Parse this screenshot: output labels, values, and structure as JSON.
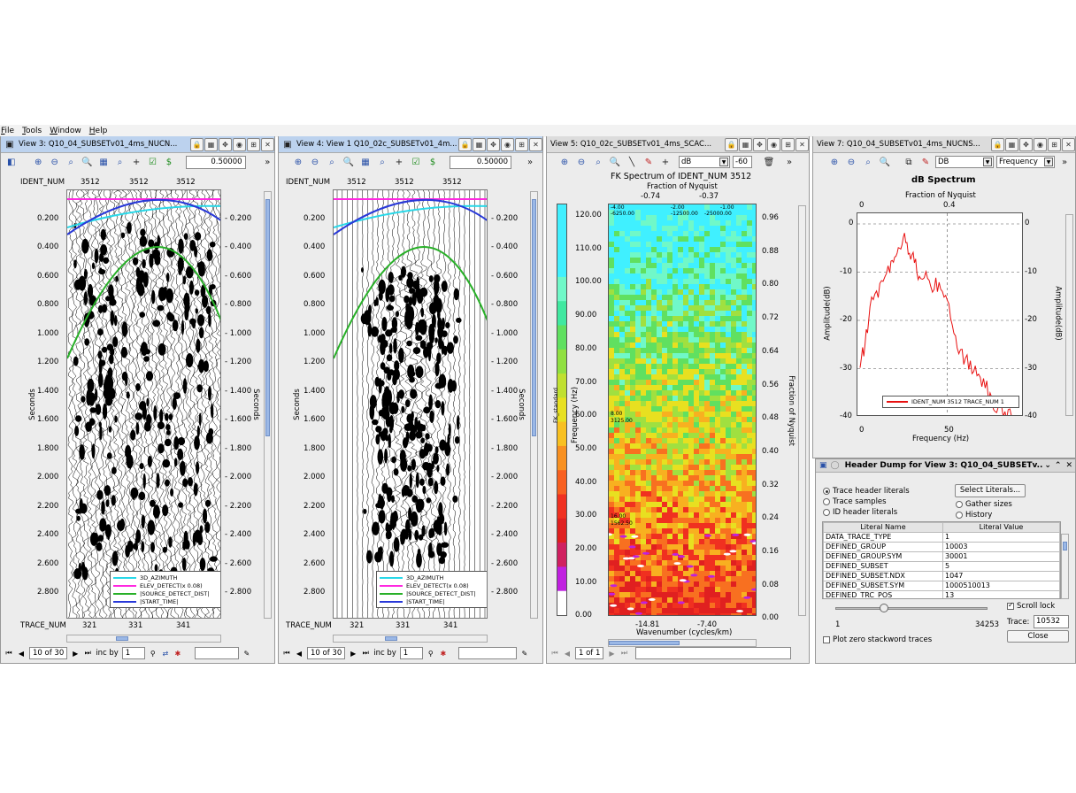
{
  "menu": [
    "File",
    "Tools",
    "Window",
    "Help"
  ],
  "view3": {
    "title": "View 3: Q10_04_SUBSETv01_4ms_NUCN...",
    "scale": "0.50000",
    "ident_label": "IDENT_NUM",
    "ident_ticks": [
      "3512",
      "3512",
      "3512"
    ],
    "trace_label": "TRACE_NUM",
    "trace_ticks": [
      "321",
      "331",
      "341"
    ],
    "axis_title": "Seconds",
    "time_ticks": [
      "0.200",
      "0.400",
      "0.600",
      "0.800",
      "1.000",
      "1.200",
      "1.400",
      "1.600",
      "1.800",
      "2.000",
      "2.200",
      "2.400",
      "2.600",
      "2.800"
    ],
    "page": "10 of 30",
    "inc_label": "inc by",
    "inc_value": "1"
  },
  "view4": {
    "title": "View 4: View 1 Q10_02c_SUBSETv01_4m...",
    "scale": "0.50000",
    "ident_label": "IDENT_NUM",
    "ident_ticks": [
      "3512",
      "3512",
      "3512"
    ],
    "trace_label": "TRACE_NUM",
    "trace_ticks": [
      "321",
      "331",
      "341"
    ],
    "axis_title": "Seconds",
    "page": "10 of 30",
    "inc_label": "inc by",
    "inc_value": "1"
  },
  "legend": [
    {
      "label": "3D_AZIMUTH",
      "color": "#28d8e8"
    },
    {
      "label": "ELEV_DETECT(x 0.08)",
      "color": "#ff28e0"
    },
    {
      "label": "|SOURCE_DETECT_DIST|",
      "color": "#28b028"
    },
    {
      "label": "|START_TIME|",
      "color": "#2838d8"
    }
  ],
  "view5": {
    "title": "View 5: Q10_02c_SUBSETv01_4ms_SCAC...",
    "unit": "dB",
    "db_min": "-60",
    "plot_title": "FK Spectrum of IDENT_NUM 3512",
    "top_axis_title": "Fraction of Nyquist",
    "top_ticks": [
      "-0.74",
      "-0.37"
    ],
    "colorbar_label": "FK_standard",
    "freq_label": "Frequency (Hz)",
    "freq_ticks": [
      "120.00",
      "110.00",
      "100.00",
      "90.00",
      "80.00",
      "70.00",
      "60.00",
      "50.00",
      "40.00",
      "30.00",
      "20.00",
      "10.00",
      "0.00"
    ],
    "nyq_ticks": [
      "0.96",
      "0.88",
      "0.80",
      "0.72",
      "0.64",
      "0.56",
      "0.48",
      "0.40",
      "0.32",
      "0.24",
      "0.16",
      "0.08",
      "0.00"
    ],
    "nyq_label": "Fraction of Nyquist",
    "wn_ticks": [
      "-14.81",
      "-7.40"
    ],
    "wn_label": "Wavenumber (cycles/km)",
    "annotations": [
      "-4.00",
      "-6250.00",
      "-2.00",
      "-12500.00",
      "-1.00",
      "-25000.00",
      "8.00",
      "3125.00",
      "16.00",
      "1562.50"
    ],
    "page": "1 of 1"
  },
  "view7": {
    "title": "View 7: Q10_04_SUBSETv01_4ms_NUCNS...",
    "unit": "DB",
    "domain": "Frequency",
    "plot_title": "dB Spectrum",
    "top_axis_title": "Fraction of Nyquist",
    "top_ticks": [
      "0",
      "0.4"
    ],
    "y_ticks": [
      "0",
      "-10",
      "-20",
      "-30",
      "-40"
    ],
    "y_label": "Amplitude(dB)",
    "x_ticks": [
      "0",
      "50"
    ],
    "x_label": "Frequency (Hz)",
    "legend": "IDENT_NUM 3512 TRACE_NUM 1"
  },
  "dump": {
    "title": "Header Dump for View 3: Q10_04_SUBSETv...",
    "radios_left": [
      "Trace header literals",
      "Trace samples",
      "ID header literals"
    ],
    "radios_right": [
      "Gather sizes",
      "History"
    ],
    "select_button": "Select Literals...",
    "columns": [
      "Literal Name",
      "Literal Value"
    ],
    "rows": [
      [
        "DATA_TRACE_TYPE",
        "1"
      ],
      [
        "DEFINED_GROUP",
        "10003"
      ],
      [
        "DEFINED_GROUP.SYM",
        "30001"
      ],
      [
        "DEFINED_SUBSET",
        "5"
      ],
      [
        "DEFINED_SUBSET.NDX",
        "1047"
      ],
      [
        "DEFINED_SUBSET.SYM",
        "1000510013"
      ],
      [
        "DEFINED_TRC_POS",
        "13"
      ]
    ],
    "slider_min": "1",
    "slider_max": "34253",
    "scroll_lock": "Scroll lock",
    "trace_label": "Trace:",
    "trace_value": "10532",
    "close": "Close",
    "plot_zero": "Plot zero stackword traces"
  },
  "spectrum_data": {
    "x_hz": [
      0,
      3,
      6,
      10,
      14,
      18,
      21,
      24,
      27,
      30,
      33,
      36,
      40,
      44,
      48,
      52,
      56,
      60,
      64,
      68,
      72,
      76,
      80,
      84,
      88,
      92
    ],
    "y_db": [
      -30,
      -25,
      -17,
      -14,
      -12,
      -10,
      -7,
      -5,
      -2,
      -6,
      -8,
      -11,
      -10,
      -14,
      -12,
      -15,
      -21,
      -27,
      -28,
      -31,
      -31,
      -34,
      -36,
      -38,
      -39,
      -40
    ]
  }
}
